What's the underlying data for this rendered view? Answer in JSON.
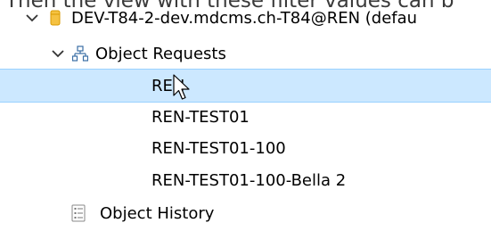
{
  "cut_text": "Then the view with these filter values can b",
  "tree": {
    "root": {
      "label": "DEV-T84-2-dev.mdcms.ch-T84@REN (defau",
      "expanded": true,
      "icon": "database-icon"
    },
    "object_requests": {
      "label": "Object Requests",
      "expanded": true,
      "icon": "hierarchy-icon"
    },
    "requests": [
      {
        "label": "REN",
        "selected": true
      },
      {
        "label": "REN-TEST01",
        "selected": false
      },
      {
        "label": "REN-TEST01-100",
        "selected": false
      },
      {
        "label": "REN-TEST01-100-Bella 2",
        "selected": false
      }
    ],
    "object_history": {
      "label": "Object History",
      "icon": "history-list-icon"
    }
  },
  "colors": {
    "selection_bg": "#cce8ff",
    "selection_border": "#99d1ff",
    "database_icon": "#f0b400"
  }
}
